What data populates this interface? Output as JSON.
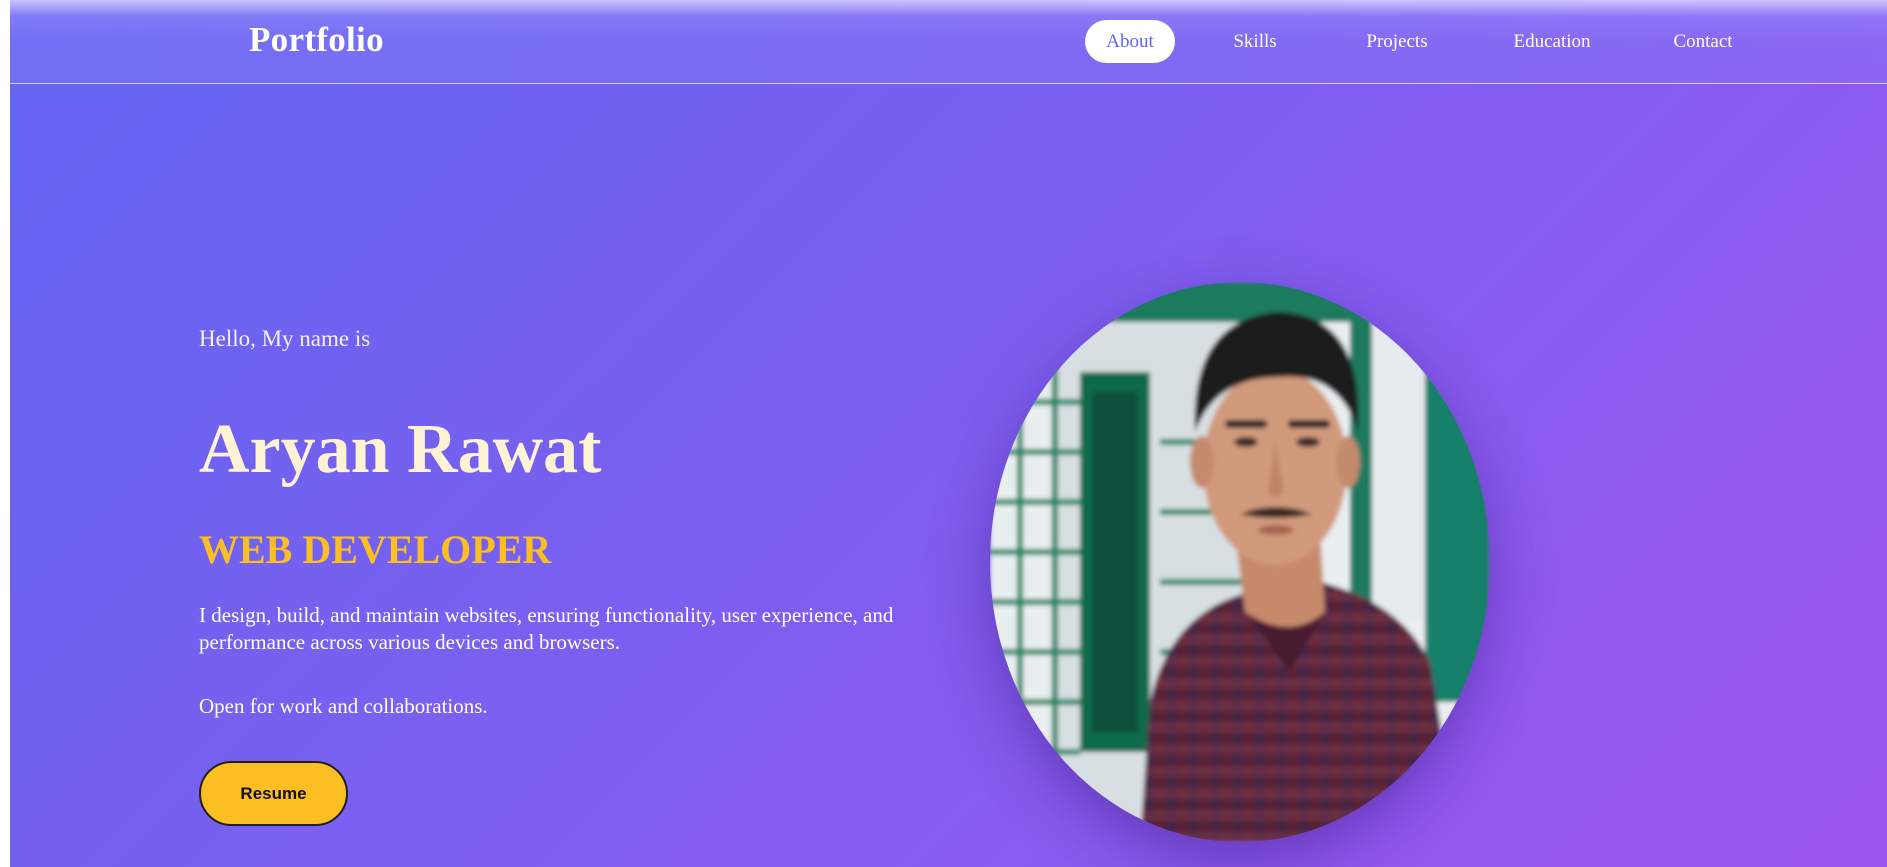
{
  "navbar": {
    "brand": "Portfolio",
    "links": [
      {
        "label": "About",
        "active": true
      },
      {
        "label": "Skills",
        "active": false
      },
      {
        "label": "Projects",
        "active": false
      },
      {
        "label": "Education",
        "active": false
      },
      {
        "label": "Contact",
        "active": false
      }
    ]
  },
  "hero": {
    "greeting": "Hello, My name is",
    "name": "Aryan Rawat",
    "role": "WEB DEVELOPER",
    "description": "I design, build, and maintain websites, ensuring functionality, user experience, and performance across various devices and browsers.",
    "availability": "Open for work and collaborations.",
    "resume_label": "Resume",
    "photo_icon": "profile-photo"
  },
  "colors": {
    "gradient_start": "#6366f1",
    "gradient_end": "#9d55f0",
    "accent": "#fbbf24",
    "name_color": "#fdf2d4"
  }
}
